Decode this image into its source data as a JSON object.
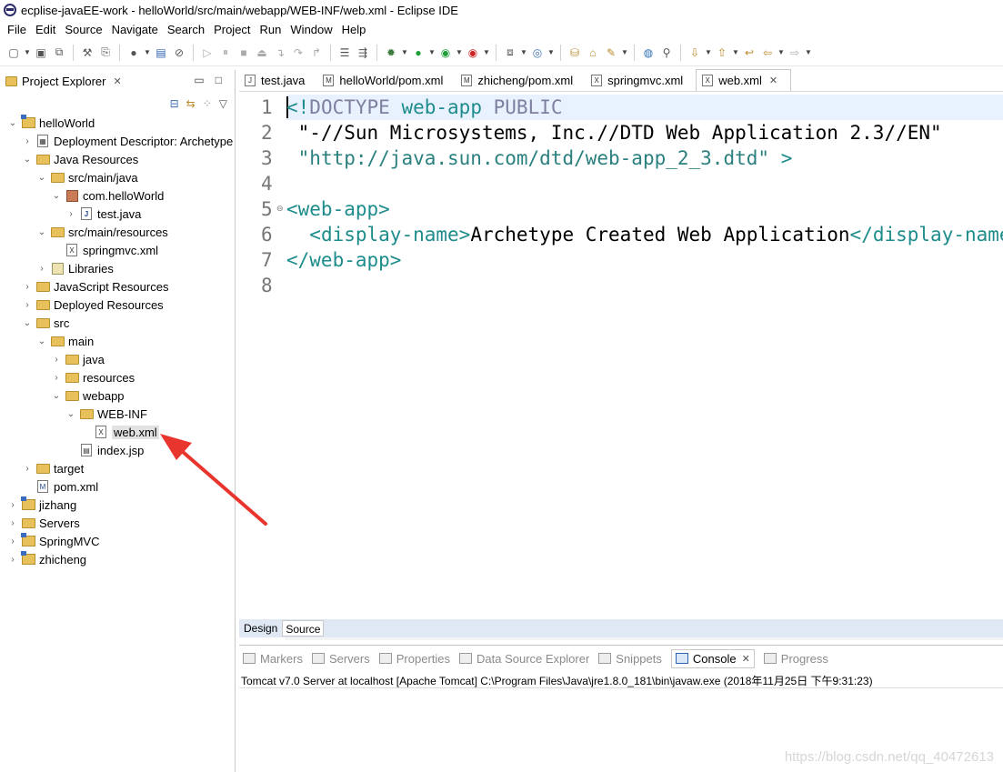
{
  "window": {
    "title": "ecplise-javaEE-work - helloWorld/src/main/webapp/WEB-INF/web.xml - Eclipse IDE"
  },
  "menubar": [
    "File",
    "Edit",
    "Source",
    "Navigate",
    "Search",
    "Project",
    "Run",
    "Window",
    "Help"
  ],
  "project_explorer": {
    "title": "Project Explorer",
    "close": "✕",
    "tree": [
      {
        "label": "helloWorld",
        "depth": 0,
        "expanded": true,
        "icon": "project-icon"
      },
      {
        "label": "Deployment Descriptor: Archetype",
        "depth": 1,
        "expanded": false,
        "icon": "descriptor-icon"
      },
      {
        "label": "Java Resources",
        "depth": 1,
        "expanded": true,
        "icon": "java-resources-icon"
      },
      {
        "label": "src/main/java",
        "depth": 2,
        "expanded": true,
        "icon": "source-folder-icon"
      },
      {
        "label": "com.helloWorld",
        "depth": 3,
        "expanded": true,
        "icon": "package-icon"
      },
      {
        "label": "test.java",
        "depth": 4,
        "expanded": false,
        "icon": "java-file-icon"
      },
      {
        "label": "src/main/resources",
        "depth": 2,
        "expanded": true,
        "icon": "source-folder-icon"
      },
      {
        "label": "springmvc.xml",
        "depth": 3,
        "expanded": null,
        "icon": "xml-file-icon"
      },
      {
        "label": "Libraries",
        "depth": 2,
        "expanded": false,
        "icon": "library-icon"
      },
      {
        "label": "JavaScript Resources",
        "depth": 1,
        "expanded": false,
        "icon": "js-resources-icon"
      },
      {
        "label": "Deployed Resources",
        "depth": 1,
        "expanded": false,
        "icon": "deployed-resources-icon"
      },
      {
        "label": "src",
        "depth": 1,
        "expanded": true,
        "icon": "folder-icon"
      },
      {
        "label": "main",
        "depth": 2,
        "expanded": true,
        "icon": "folder-icon"
      },
      {
        "label": "java",
        "depth": 3,
        "expanded": false,
        "icon": "folder-icon"
      },
      {
        "label": "resources",
        "depth": 3,
        "expanded": false,
        "icon": "folder-icon"
      },
      {
        "label": "webapp",
        "depth": 3,
        "expanded": true,
        "icon": "folder-icon"
      },
      {
        "label": "WEB-INF",
        "depth": 4,
        "expanded": true,
        "icon": "folder-icon"
      },
      {
        "label": "web.xml",
        "depth": 5,
        "expanded": null,
        "icon": "xml-file-icon",
        "selected": true
      },
      {
        "label": "index.jsp",
        "depth": 4,
        "expanded": null,
        "icon": "jsp-file-icon"
      },
      {
        "label": "target",
        "depth": 1,
        "expanded": false,
        "icon": "folder-icon"
      },
      {
        "label": "pom.xml",
        "depth": 1,
        "expanded": null,
        "icon": "maven-file-icon"
      },
      {
        "label": "jizhang",
        "depth": 0,
        "expanded": false,
        "icon": "project-icon"
      },
      {
        "label": "Servers",
        "depth": 0,
        "expanded": false,
        "icon": "folder-icon"
      },
      {
        "label": "SpringMVC",
        "depth": 0,
        "expanded": false,
        "icon": "project-icon"
      },
      {
        "label": "zhicheng",
        "depth": 0,
        "expanded": false,
        "icon": "project-icon"
      }
    ]
  },
  "editor": {
    "tabs": [
      {
        "label": "test.java",
        "icon": "J",
        "active": false
      },
      {
        "label": "helloWorld/pom.xml",
        "icon": "M",
        "active": false
      },
      {
        "label": "zhicheng/pom.xml",
        "icon": "M",
        "active": false
      },
      {
        "label": "springmvc.xml",
        "icon": "X",
        "active": false
      },
      {
        "label": "web.xml",
        "icon": "X",
        "active": true
      }
    ],
    "line_numbers": [
      "1",
      "2",
      "3",
      "4",
      "5",
      "6",
      "7",
      "8"
    ],
    "lines": [
      "<!DOCTYPE web-app PUBLIC",
      " \"-//Sun Microsystems, Inc.//DTD Web Application 2.3//EN\"",
      " \"http://java.sun.com/dtd/web-app_2_3.dtd\" >",
      "",
      "<web-app>",
      "  <display-name>Archetype Created Web Application</display-name>",
      "</web-app>",
      ""
    ],
    "bottom_tabs": [
      "Design",
      "Source"
    ],
    "active_bottom_tab": "Source"
  },
  "console": {
    "tabs": [
      {
        "label": "Markers",
        "active": false
      },
      {
        "label": "Servers",
        "active": false
      },
      {
        "label": "Properties",
        "active": false
      },
      {
        "label": "Data Source Explorer",
        "active": false
      },
      {
        "label": "Snippets",
        "active": false
      },
      {
        "label": "Console",
        "active": true
      },
      {
        "label": "Progress",
        "active": false
      }
    ],
    "output": "Tomcat v7.0 Server at localhost [Apache Tomcat] C:\\Program Files\\Java\\jre1.8.0_181\\bin\\javaw.exe (2018年11月25日 下午9:31:23)"
  },
  "colors": {
    "arrow": "#e8362f",
    "current_line": "#e8f2fe",
    "tag": "#1e8c8c"
  },
  "watermark": "https://blog.csdn.net/qq_40472613"
}
